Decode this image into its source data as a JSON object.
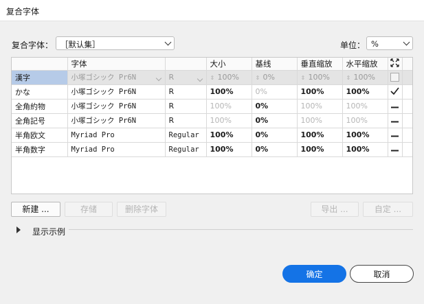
{
  "window": {
    "title": "复合字体"
  },
  "top": {
    "composite_label": "复合字体：",
    "composite_value": "［默认集］",
    "unit_label": "单位：",
    "unit_value": "%"
  },
  "table": {
    "headers": [
      "",
      "字体",
      "",
      "大小",
      "基线",
      "垂直缩放",
      "水平缩放"
    ],
    "rows": [
      {
        "name": "漢字",
        "font": "小塚ゴシック Pr6N",
        "style": "R",
        "size": "100%",
        "baseline": "0%",
        "vscale": "100%",
        "hscale": "100%",
        "mark": "checkbox"
      },
      {
        "name": "かな",
        "font": "小塚ゴシック Pr6N",
        "style": "R",
        "size": "100%",
        "baseline": "0%",
        "vscale": "100%",
        "hscale": "100%",
        "mark": "check"
      },
      {
        "name": "全角約物",
        "font": "小塚ゴシック Pr6N",
        "style": "R",
        "size": "100%",
        "baseline": "0%",
        "vscale": "100%",
        "hscale": "100%",
        "mark": "dash"
      },
      {
        "name": "全角記号",
        "font": "小塚ゴシック Pr6N",
        "style": "R",
        "size": "100%",
        "baseline": "0%",
        "vscale": "100%",
        "hscale": "100%",
        "mark": "dash"
      },
      {
        "name": "半角欧文",
        "font": "Myriad Pro",
        "style": "Regular",
        "size": "100%",
        "baseline": "0%",
        "vscale": "100%",
        "hscale": "100%",
        "mark": "dash"
      },
      {
        "name": "半角数字",
        "font": "Myriad Pro",
        "style": "Regular",
        "size": "100%",
        "baseline": "0%",
        "vscale": "100%",
        "hscale": "100%",
        "mark": "dash"
      }
    ]
  },
  "buttons": {
    "new": "新建 ...",
    "save": "存储",
    "delete_font": "删除字体",
    "export": "导出 ...",
    "custom": "自定 ..."
  },
  "preview": {
    "label": "显示示例"
  },
  "footer": {
    "ok": "确定",
    "cancel": "取消"
  },
  "colors": {
    "accent": "#1473e6",
    "selection": "#b6cbe8"
  }
}
